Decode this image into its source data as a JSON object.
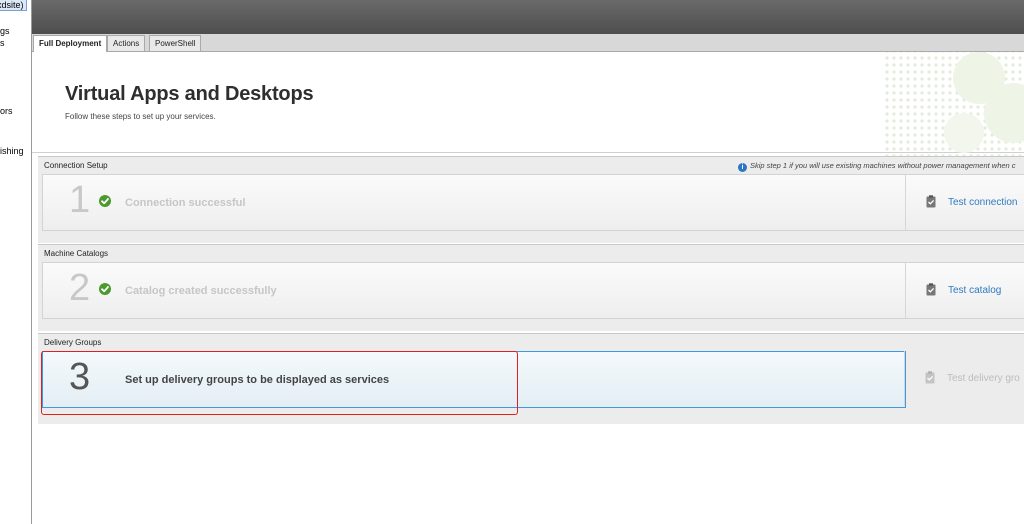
{
  "left_panel": {
    "root_label": "lxdsite)",
    "items": [
      "gs",
      "s",
      "ors",
      "ishing"
    ]
  },
  "tabs": [
    {
      "label": "Full Deployment",
      "active": true
    },
    {
      "label": "Actions",
      "active": false
    },
    {
      "label": "PowerShell",
      "active": false
    }
  ],
  "hero": {
    "title": "Virtual Apps and Desktops",
    "subtitle": "Follow these steps to set up your services."
  },
  "sections": [
    {
      "label": "Connection Setup",
      "note": "Skip step 1 if you will use existing machines without power management when c",
      "step_number": "1",
      "status_text": "Connection successful",
      "action_label": "Test connection",
      "completed": true
    },
    {
      "label": "Machine Catalogs",
      "step_number": "2",
      "status_text": "Catalog created successfully",
      "action_label": "Test catalog",
      "completed": true
    },
    {
      "label": "Delivery Groups",
      "step_number": "3",
      "status_text": "Set up delivery groups to be displayed as services",
      "action_label": "Test delivery gro",
      "completed": false
    }
  ],
  "colors": {
    "accent_blue": "#2f7bc2",
    "check_green": "#4a9a2e",
    "highlight_red": "#e02020",
    "active_border": "#3e9ae0"
  }
}
